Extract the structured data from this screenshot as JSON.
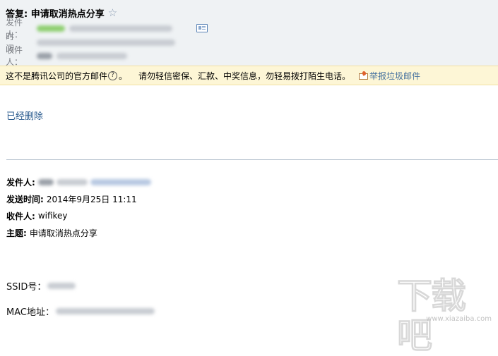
{
  "header": {
    "subject": "答复: 申请取消热点分享",
    "from_label": "发件人：",
    "time_label": "时　间：",
    "to_label": "收件人："
  },
  "warning": {
    "text": "这不是腾讯公司的官方邮件",
    "tip": "请勿轻信密保、汇款、中奖信息，勿轻易拨打陌生电话。",
    "report": "举报垃圾邮件"
  },
  "body": {
    "deleted_text": "已经删除",
    "quote": {
      "from_label": "发件人:",
      "sent_label": "发送时间:",
      "sent_value": "2014年9月25日 11:11",
      "to_label": "收件人:",
      "to_value": "wifikey",
      "subject_label": "主题:",
      "subject_value": "申请取消热点分享"
    },
    "ssid_label": "SSID号：",
    "mac_label": "MAC地址："
  },
  "watermark": {
    "big": "下载吧",
    "small": "www.xiazaiba.com"
  },
  "colors": {
    "header_bg": "#eff2f4",
    "warning_bg": "#fdf6d6",
    "link": "#2a5b8e",
    "star_icon": "star-outline-icon"
  }
}
